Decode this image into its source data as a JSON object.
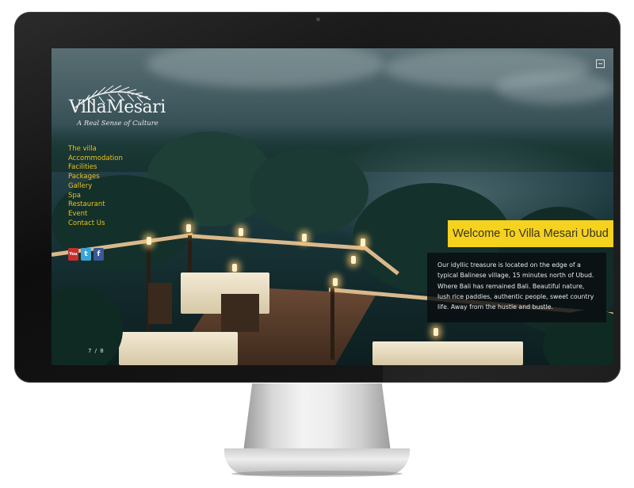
{
  "brand": {
    "name": "VillaMesari",
    "tagline": "A Real Sense of Culture"
  },
  "nav": {
    "items": [
      "The villa",
      "Accommodation",
      "Facilities",
      "Packages",
      "Gallery",
      "Spa",
      "Restaurant",
      "Event",
      "Contact Us"
    ]
  },
  "social": {
    "youtube": "You",
    "twitter": "t",
    "facebook": "f"
  },
  "slider": {
    "counter": "7 / 8"
  },
  "welcome": {
    "title": "Welcome To Villa Mesari Ubud",
    "text": "Our idyllic treasure is located on the edge of a typical Balinese village, 15 minutes north of Ubud. Where Bali has remained Bali. Beautiful nature, lush rice paddies, authentic people, sweet country life. Away from the hustle and bustle."
  },
  "colors": {
    "menu_text": "#e8c21a",
    "welcome_bg": "#f4d21e",
    "intro_bg": "#0a0e10"
  },
  "icons": {
    "toggle": "minimize-icon",
    "logo": "palm-leaf-icon"
  }
}
